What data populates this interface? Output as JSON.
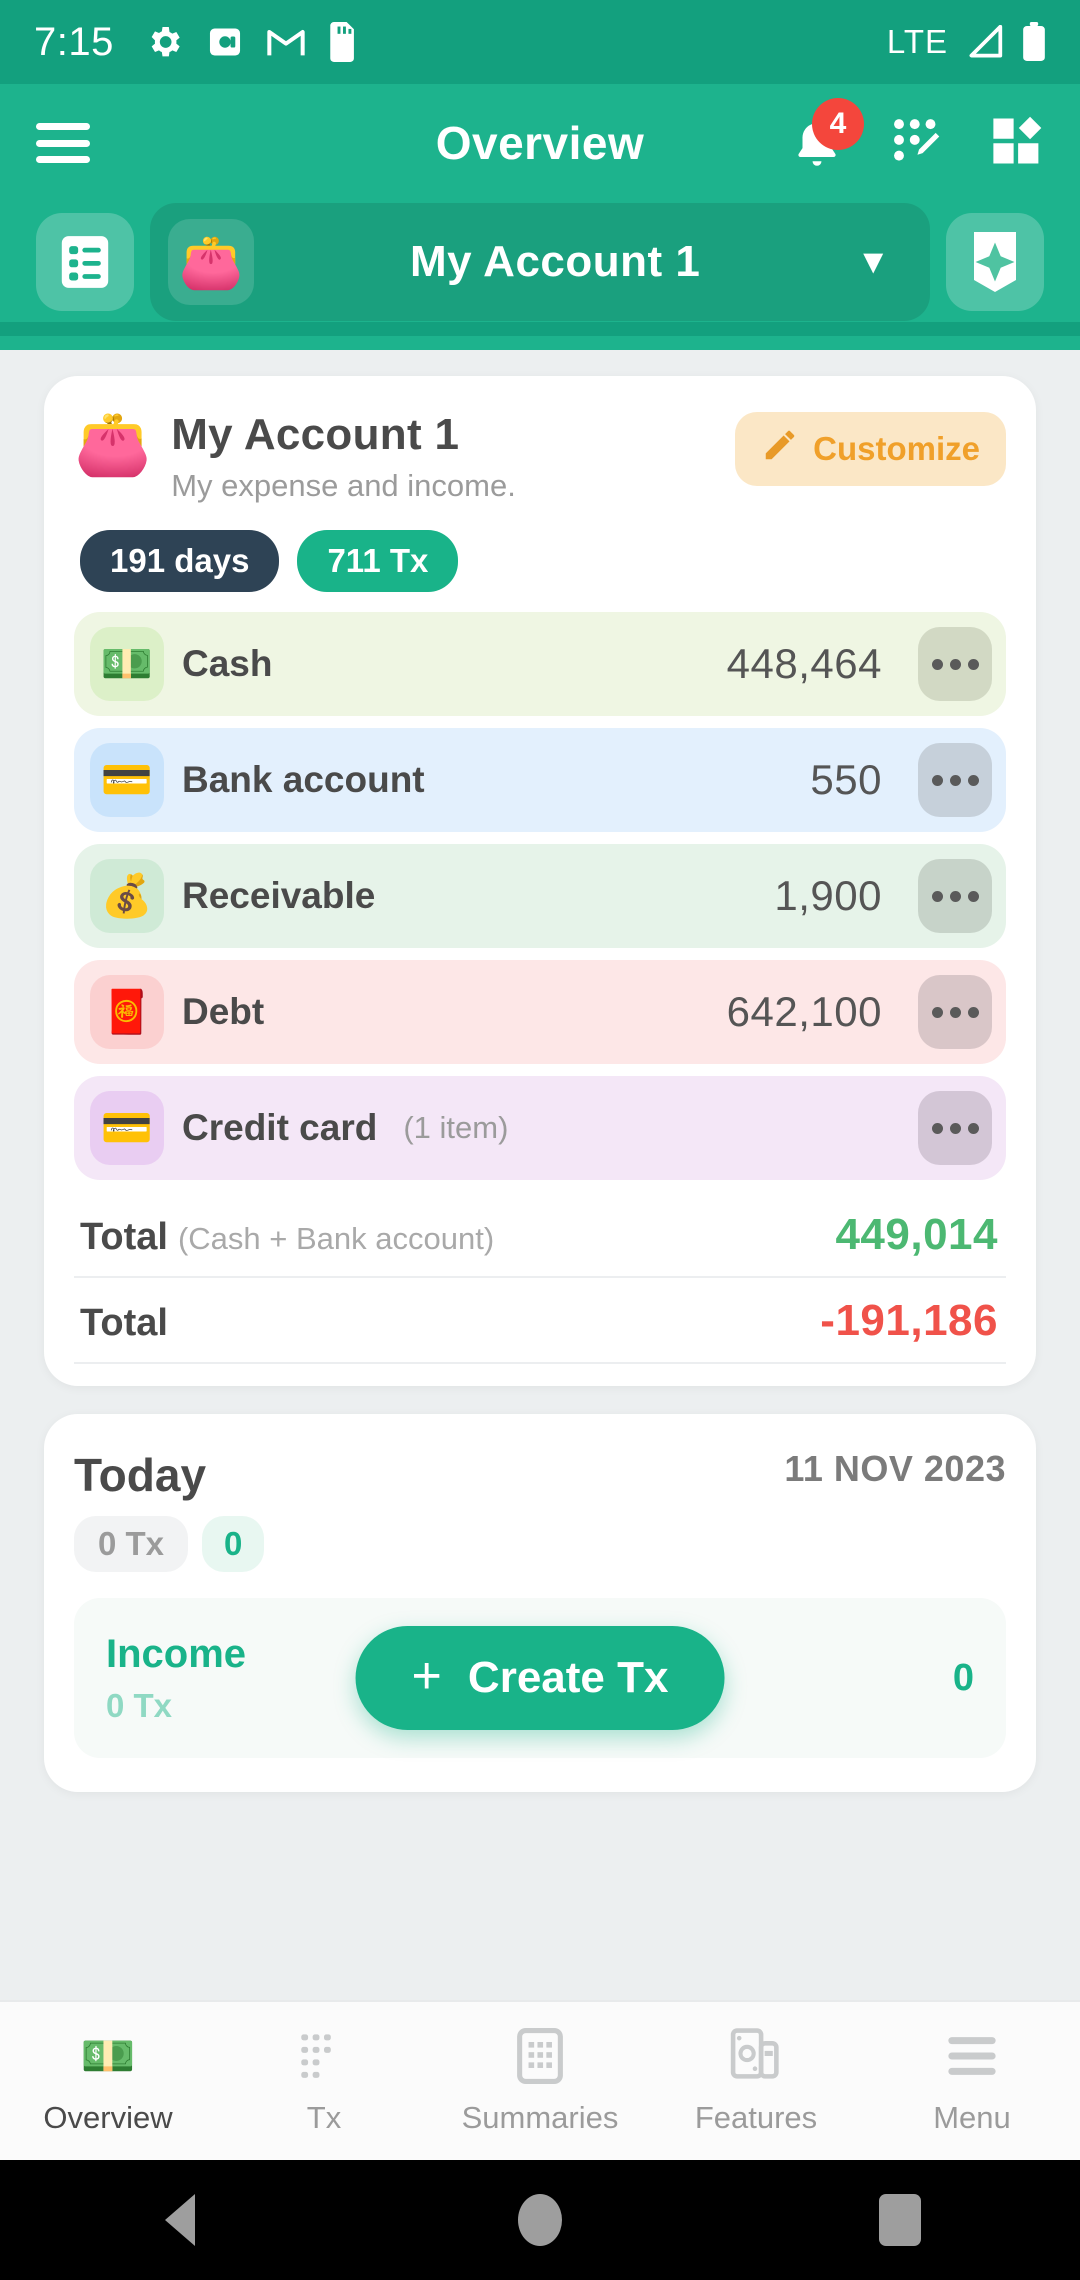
{
  "status_bar": {
    "time": "7:15",
    "icons": [
      "gear-icon",
      "screenshot-icon",
      "gmail-icon",
      "sdcard-icon"
    ],
    "network": "LTE",
    "signal_icon": "signal-icon",
    "battery_icon": "battery-icon"
  },
  "app_bar": {
    "title": "Overview",
    "menu_icon": "hamburger-menu-icon",
    "notification_icon": "bell-icon",
    "notification_count": "4",
    "edit_grid_icon": "edit-grid-icon",
    "apps_icon": "apps-grid-icon"
  },
  "account_selector": {
    "list_icon": "list-view-icon",
    "wallet_emoji": "👛",
    "account_name": "My Account 1",
    "caret_icon": "chevron-down-icon",
    "sparkle_icon": "sparkle-icon"
  },
  "account_card": {
    "emoji": "👛",
    "name": "My Account 1",
    "subtitle": "My expense and income.",
    "customize_label": "Customize",
    "customize_icon": "pencil-icon",
    "chips": [
      {
        "label": "191 days",
        "style": "dark"
      },
      {
        "label": "711 Tx",
        "style": "green"
      }
    ],
    "rows": [
      {
        "emoji": "💵",
        "label": "Cash",
        "count": "",
        "amount": "448,464",
        "bg": "#eff6e3",
        "icon_bg": "#dcf0c8",
        "more_bg": "#d2d9c4"
      },
      {
        "emoji": "💳",
        "label": "Bank account",
        "count": "",
        "amount": "550",
        "bg": "#e3f0fd",
        "icon_bg": "#c9e3fb",
        "more_bg": "#c6d0da"
      },
      {
        "emoji": "💰",
        "label": "Receivable",
        "count": "",
        "amount": "1,900",
        "bg": "#e6f3e9",
        "icon_bg": "#cfead6",
        "more_bg": "#c7d3c9"
      },
      {
        "emoji": "🧧",
        "label": "Debt",
        "count": "",
        "amount": "642,100",
        "bg": "#fde7e7",
        "icon_bg": "#fbd0d0",
        "more_bg": "#d9c6c8"
      },
      {
        "emoji": "💳",
        "label": "Credit card",
        "count": "(1 item)",
        "amount": "",
        "bg": "#f4e7f7",
        "icon_bg": "#e9cdf2",
        "more_bg": "#d3c6d6"
      }
    ],
    "totals": [
      {
        "label": "Total",
        "note": "(Cash + Bank account)",
        "value": "449,014",
        "sign": "pos"
      },
      {
        "label": "Total",
        "note": "",
        "value": "-191,186",
        "sign": "neg"
      }
    ]
  },
  "today_card": {
    "title": "Today",
    "date": "11 NOV 2023",
    "tx_chip": "0 Tx",
    "amount_chip": "0",
    "income": {
      "label": "Income",
      "tx_count": "0 Tx",
      "amount": "0"
    },
    "create_tx_label": "Create Tx",
    "create_tx_icon": "plus-icon"
  },
  "bottom_nav": {
    "items": [
      {
        "label": "Overview",
        "icon": "money-icon",
        "emoji": "💵",
        "active": true
      },
      {
        "label": "Tx",
        "icon": "list-dots-icon",
        "emoji": "",
        "active": false
      },
      {
        "label": "Summaries",
        "icon": "grid-icon",
        "emoji": "",
        "active": false
      },
      {
        "label": "Features",
        "icon": "cash-icon",
        "emoji": "",
        "active": false
      },
      {
        "label": "Menu",
        "icon": "menu-lines-icon",
        "emoji": "",
        "active": false
      }
    ]
  },
  "android_nav": {
    "back_icon": "back-triangle-icon",
    "home_icon": "home-circle-icon",
    "recents_icon": "recents-square-icon"
  },
  "colors": {
    "brand": "#1db38d",
    "brand_dark": "#13a07e",
    "accent_orange": "#f0a02a",
    "positive": "#4cb872",
    "negative": "#f0524a"
  }
}
